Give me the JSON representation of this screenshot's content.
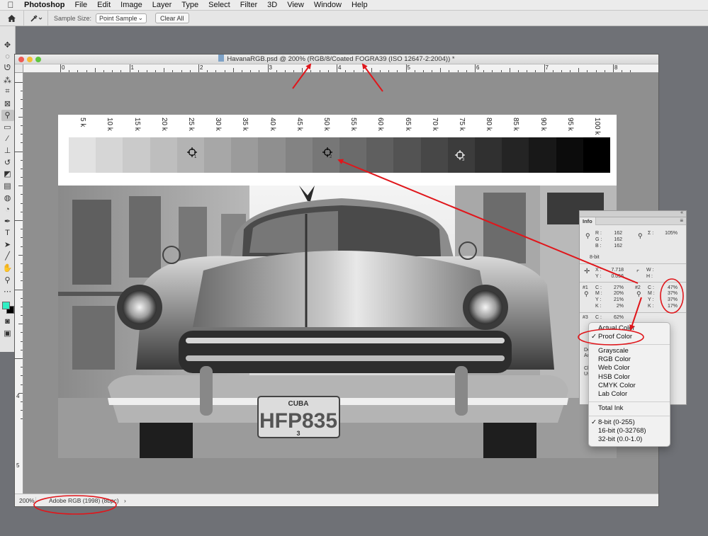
{
  "menubar": {
    "items": [
      "Photoshop",
      "File",
      "Edit",
      "Image",
      "Layer",
      "Type",
      "Select",
      "Filter",
      "3D",
      "View",
      "Window",
      "Help"
    ]
  },
  "options": {
    "sample_size_label": "Sample Size:",
    "sample_size_value": "Point Sample",
    "clear_all": "Clear All"
  },
  "document": {
    "title": "HavanaRGB.psd @ 200% (RGB/8/Coated FOGRA39 (ISO 12647-2:2004)) *",
    "zoom": "200%",
    "profile": "Adobe RGB (1998) (8bpc)",
    "hruler_labels": [
      "0",
      "1",
      "2",
      "3",
      "4",
      "5",
      "6",
      "7",
      "8"
    ],
    "vruler_labels": [
      "4",
      "5"
    ],
    "ramp_labels": [
      "5 k",
      "10 k",
      "15 k",
      "20 k",
      "25 k",
      "30 k",
      "35 k",
      "40 k",
      "45 k",
      "50 k",
      "55 k",
      "60 k",
      "65 k",
      "70 k",
      "75 k",
      "80 k",
      "85 k",
      "90 k",
      "95 k",
      "100 k"
    ],
    "plate_top": "CUBA",
    "plate_main": "HFP835",
    "plate_sub": "3",
    "samplers": [
      "1",
      "2",
      "3"
    ]
  },
  "info_panel": {
    "tab": "Info",
    "rgb": {
      "r_label": "R :",
      "r": "162",
      "g_label": "G :",
      "g": "162",
      "b_label": "B :",
      "b": "162"
    },
    "sigma": {
      "label": "Σ :",
      "value": "105%"
    },
    "bit": "8-bit",
    "xy": {
      "x_label": "X :",
      "x": "7.718",
      "y_label": "Y :",
      "y": "0.056"
    },
    "wh": {
      "w_label": "W :",
      "h_label": "H :"
    },
    "s1": {
      "tag": "#1",
      "c_label": "C :",
      "c": "27%",
      "m_label": "M :",
      "m": "20%",
      "y_label": "Y :",
      "y": "21%",
      "k_label": "K :",
      "k": "2%"
    },
    "s2": {
      "tag": "#2",
      "c_label": "C :",
      "c": "47%",
      "m_label": "M :",
      "m": "37%",
      "y_label": "Y :",
      "y": "37%",
      "k_label": "K :",
      "k": "17%"
    },
    "s3": {
      "tag": "#3",
      "c_label": "C :",
      "c": "62%"
    },
    "cut_do": "Do",
    "cut_ac": "Ac",
    "cut_cl": "Cl",
    "cut_us": "Us"
  },
  "menu": {
    "items": [
      "Actual Color",
      "Proof Color",
      "Grayscale",
      "RGB Color",
      "Web Color",
      "HSB Color",
      "CMYK Color",
      "Lab Color",
      "Total Ink",
      "8-bit (0-255)",
      "16-bit (0-32768)",
      "32-bit (0.0-1.0)"
    ],
    "checked": [
      "Proof Color",
      "8-bit (0-255)"
    ]
  },
  "colors": {
    "annotation_red": "#e0161b",
    "foreground": "#2ff0c4",
    "background": "#000000"
  },
  "ramp_levels": [
    5,
    10,
    15,
    20,
    25,
    30,
    35,
    40,
    45,
    50,
    55,
    60,
    65,
    70,
    75,
    80,
    85,
    90,
    95,
    100
  ]
}
